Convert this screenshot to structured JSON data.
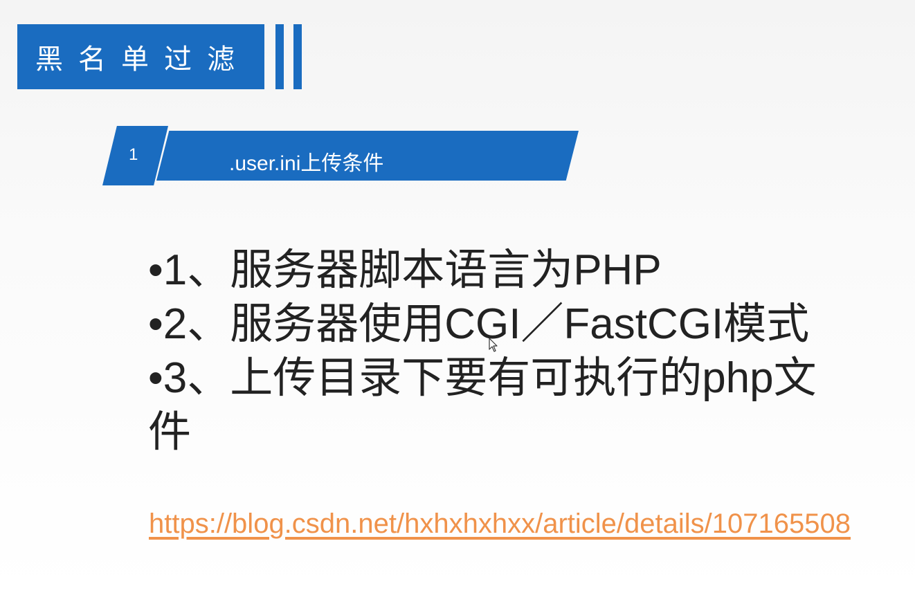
{
  "slide": {
    "title": "黑名单过滤",
    "section": {
      "number": "1",
      "title": ".user.ini上传条件"
    },
    "bullets": [
      "•1、服务器脚本语言为PHP",
      "•2、服务器使用CGI／FastCGI模式",
      "•3、上传目录下要有可执行的php文件"
    ],
    "link": "https://blog.csdn.net/hxhxhxhxx/article/details/107165508"
  },
  "colors": {
    "accent": "#1a6cc0",
    "link": "#f0924a",
    "text": "#222222"
  },
  "icons": [
    "mouse-cursor-icon"
  ]
}
